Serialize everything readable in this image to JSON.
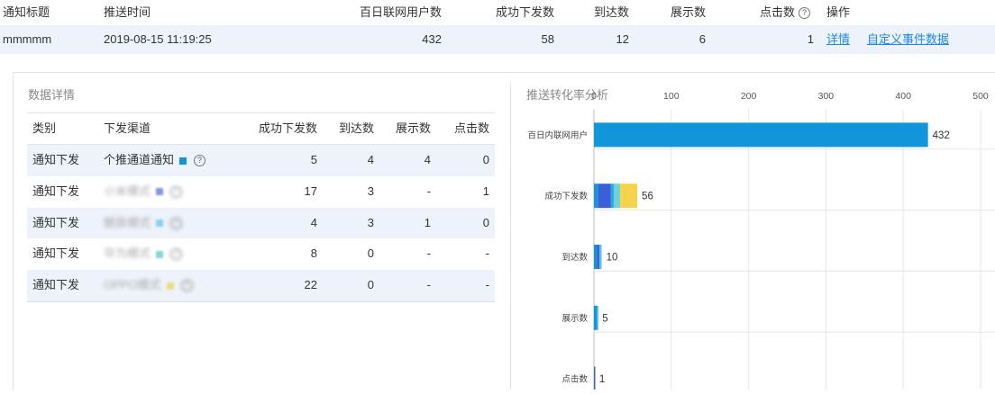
{
  "top_table": {
    "headers": {
      "title": "通知标题",
      "time": "推送时间",
      "users": "百日联网用户数",
      "sent": "成功下发数",
      "reached": "到达数",
      "shown": "展示数",
      "clicked": "点击数",
      "help_glyph": "?",
      "actions": "操作"
    },
    "row": {
      "title": "mmmmm",
      "time": "2019-08-15 11:19:25",
      "users": "432",
      "sent": "58",
      "reached": "12",
      "shown": "6",
      "clicked": "1",
      "detail_link": "详情",
      "custom_link": "自定义事件数据"
    }
  },
  "detail": {
    "title": "数据详情",
    "headers": [
      "类别",
      "下发渠道",
      "成功下发数",
      "到达数",
      "展示数",
      "点击数"
    ],
    "help_glyph": "?",
    "rows": [
      {
        "type": "通知下发",
        "channel": "个推通道通知",
        "blurred": false,
        "color": "#1296db",
        "sent": "5",
        "reached": "4",
        "shown": "4",
        "clicked": "0"
      },
      {
        "type": "通知下发",
        "channel": "小米模式",
        "blurred": true,
        "color": "#4a6cd8",
        "sent": "17",
        "reached": "3",
        "shown": "-",
        "clicked": "1"
      },
      {
        "type": "通知下发",
        "channel": "魅族模式",
        "blurred": true,
        "color": "#5fc1f0",
        "sent": "4",
        "reached": "3",
        "shown": "1",
        "clicked": "0"
      },
      {
        "type": "通知下发",
        "channel": "华为模式",
        "blurred": true,
        "color": "#4cc9c0",
        "sent": "8",
        "reached": "0",
        "shown": "-",
        "clicked": "-"
      },
      {
        "type": "通知下发",
        "channel": "OPPO模式",
        "blurred": true,
        "color": "#f0d050",
        "sent": "22",
        "reached": "0",
        "shown": "-",
        "clicked": "-"
      }
    ]
  },
  "chart_data": {
    "type": "bar",
    "orientation": "horizontal",
    "title": "推送转化率分析",
    "categories": [
      "百日内联网用户",
      "成功下发数",
      "到达数",
      "展示数",
      "点击数"
    ],
    "totals": [
      "432",
      "56",
      "10",
      "5",
      "1"
    ],
    "x_ticks": [
      "0",
      "100",
      "200",
      "300",
      "400",
      "500"
    ],
    "xlim": [
      0,
      500
    ],
    "grid": true,
    "segments": [
      [
        {
          "value": 432,
          "color": "#1296db"
        }
      ],
      [
        {
          "value": 5,
          "color": "#1296db"
        },
        {
          "value": 17,
          "color": "#3b5fd6"
        },
        {
          "value": 4,
          "color": "#2ea8e8"
        },
        {
          "value": 8,
          "color": "#6fd3d6"
        },
        {
          "value": 22,
          "color": "#f5d24a"
        }
      ],
      [
        {
          "value": 4,
          "color": "#1296db"
        },
        {
          "value": 3,
          "color": "#3b5fd6"
        },
        {
          "value": 3,
          "color": "#5fc1f0"
        }
      ],
      [
        {
          "value": 4,
          "color": "#1296db"
        },
        {
          "value": 1,
          "color": "#5fc1f0"
        }
      ],
      [
        {
          "value": 1,
          "color": "#3b5fd6"
        }
      ]
    ]
  }
}
